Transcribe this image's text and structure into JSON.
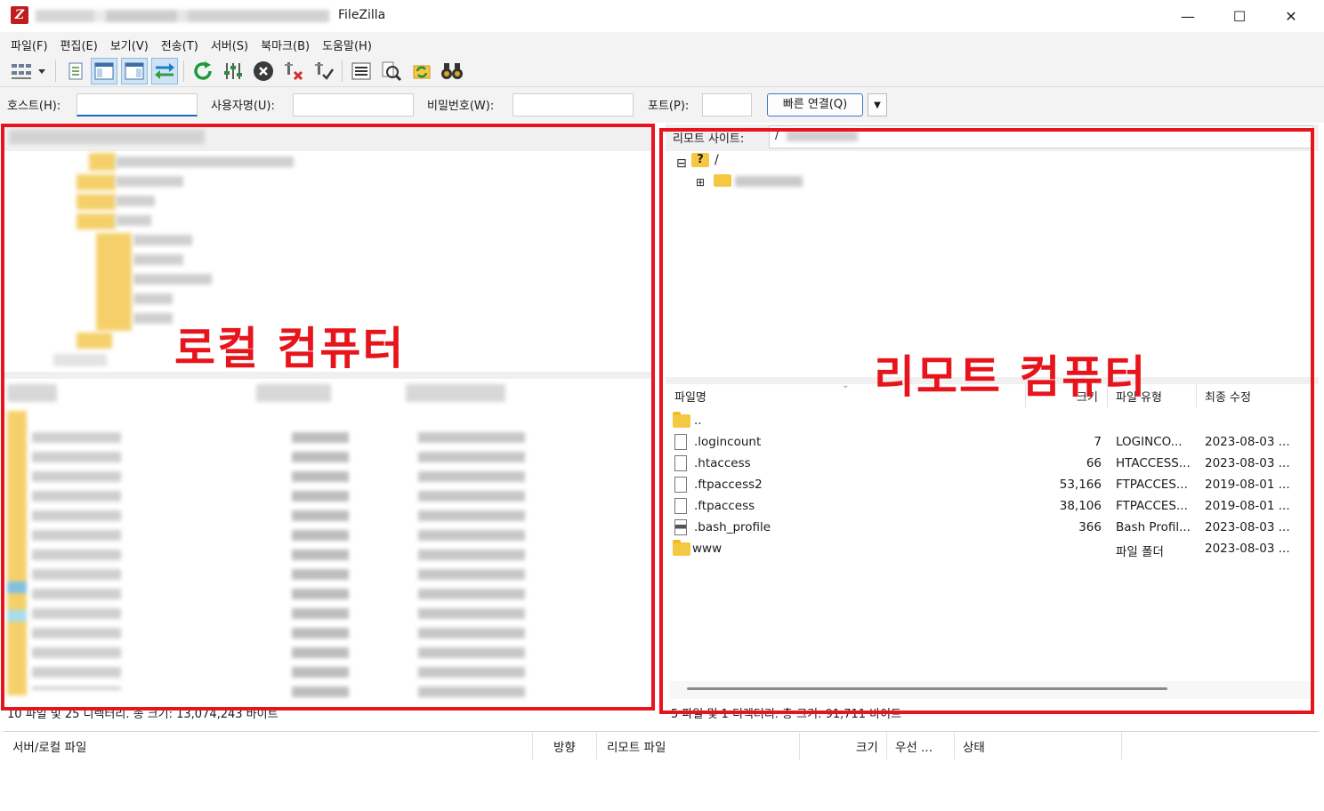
{
  "window": {
    "title": "FileZilla",
    "min_glyph": "—",
    "max_glyph": "☐",
    "close_glyph": "✕"
  },
  "menu": [
    "파일(F)",
    "편집(E)",
    "보기(V)",
    "전송(T)",
    "서버(S)",
    "북마크(B)",
    "도움말(H)"
  ],
  "quickconnect": {
    "host_label": "호스트(H):",
    "host_value": "",
    "user_label": "사용자명(U):",
    "user_value": "",
    "pass_label": "비밀번호(W):",
    "pass_value": "",
    "port_label": "포트(P):",
    "port_value": "",
    "connect_button": "빠른 연결(Q)"
  },
  "remote": {
    "site_label": "리모트 사이트:",
    "path_prefix": "/",
    "tree_root": "/",
    "columns": {
      "name": "파일명",
      "size": "크기",
      "type": "파일 유형",
      "modified": "최종 수정"
    },
    "parent_dir": "..",
    "files": [
      {
        "name": ".logincount",
        "size": "7",
        "type": "LOGINCO...",
        "modified": "2023-08-03 ...",
        "icon": "document"
      },
      {
        "name": ".htaccess",
        "size": "66",
        "type": "HTACCESS...",
        "modified": "2023-08-03 ...",
        "icon": "document"
      },
      {
        "name": ".ftpaccess2",
        "size": "53,166",
        "type": "FTPACCES...",
        "modified": "2019-08-01 ...",
        "icon": "document"
      },
      {
        "name": ".ftpaccess",
        "size": "38,106",
        "type": "FTPACCES...",
        "modified": "2019-08-01 ...",
        "icon": "document"
      },
      {
        "name": ".bash_profile",
        "size": "366",
        "type": "Bash Profil...",
        "modified": "2023-08-03 ...",
        "icon": "script"
      },
      {
        "name": "www",
        "size": "",
        "type": "파일 폴더",
        "modified": "2023-08-03 ...",
        "icon": "folder"
      }
    ],
    "status": "5 파일 및 1 디렉터리. 총 크기: 91,711 바이트"
  },
  "local": {
    "status": "10 파일 및 25 디렉터리. 총 크기: 13,074,243 바이트"
  },
  "queue": {
    "columns": {
      "server_local": "서버/로컬 파일",
      "direction": "방향",
      "remote_file": "리모트 파일",
      "size": "크기",
      "priority": "우선 ...",
      "status": "상태"
    }
  },
  "annotations": {
    "local_label": "로컬 컴퓨터",
    "remote_label": "리모트 컴퓨터",
    "color": "#e8141c"
  }
}
